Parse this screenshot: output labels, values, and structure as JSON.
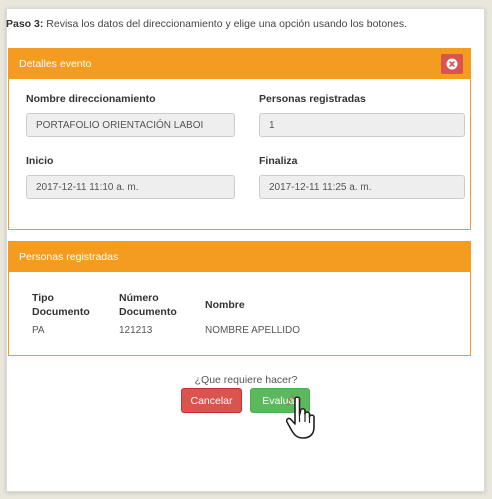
{
  "step": {
    "prefix": "Paso 3:",
    "text": "Revisa los datos del direccionamiento y elige una opción usando los botones."
  },
  "event_panel": {
    "title": "Detalles evento",
    "fields": {
      "nombre_label": "Nombre direccionamiento",
      "nombre_value": "PORTAFOLIO ORIENTACIÓN LABOI",
      "personas_label": "Personas registradas",
      "personas_value": "1",
      "inicio_label": "Inicio",
      "inicio_value": "2017-12-11 11:10 a. m.",
      "finaliza_label": "Finaliza",
      "finaliza_value": "2017-12-11 11:25 a. m."
    }
  },
  "persons_panel": {
    "title": "Personas registradas",
    "columns": {
      "tipo_line1": "Tipo",
      "tipo_line2": "Documento",
      "numero_line1": "Número",
      "numero_line2": "Documento",
      "nombre": "Nombre"
    },
    "rows": [
      {
        "tipo": "PA",
        "numero": "121213",
        "nombre": "NOMBRE APELLIDO"
      }
    ]
  },
  "actions": {
    "question": "¿Que requiere hacer?",
    "cancel_label": "Cancelar",
    "evaluate_label": "Evaluar"
  },
  "icons": {
    "close": "close-circle-icon",
    "cursor": "hand-pointer-icon"
  },
  "colors": {
    "panel_header": "#f39c1f",
    "cancel": "#d9534f",
    "evaluate": "#5cb85c"
  }
}
